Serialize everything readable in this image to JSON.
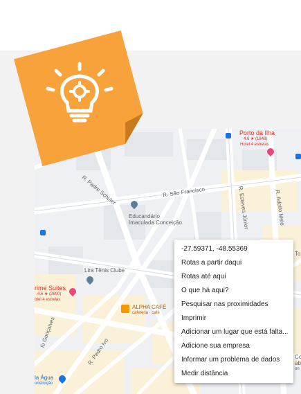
{
  "map": {
    "streets": {
      "sao_francisco": "R. São Francisco",
      "padre_schuler": "R. Padre Schuler",
      "esteves_junior": "R. Esteves Júnior",
      "adolfo_melo": "R. Adolfo Melo",
      "pedro_ivo": "R. Pedro Ivo",
      "goncalves": "lo Gonçalves"
    },
    "places": {
      "porto_da_ilha": {
        "name": "Porto da Ilha",
        "rating": "4.6 ★ (1848)",
        "category": "Hotel 4 estrelas"
      },
      "educandario": {
        "name_line1": "Educandário",
        "name_line2": "Imaculada Conceição"
      },
      "lira_tenis": {
        "name": "Lira Tênis Clube"
      },
      "prime_suites": {
        "name": "rime Suites",
        "rating": "4.6 ★ (2600)",
        "category": "otel 4 estrelas"
      },
      "alpha_cafe": {
        "name": "ALPHA CAFÉ",
        "category": "cafeteria · café"
      },
      "la_agua": {
        "name": "la Água",
        "category": "onstrução"
      },
      "edge_to": "To",
      "edge_co": "Co",
      "edge_ab": "ab",
      "edge_on": "on"
    }
  },
  "context_menu": {
    "items": [
      "-27.59371, -48.55369",
      "Rotas a partir daqui",
      "Rotas até aqui",
      "O que há aqui?",
      "Pesquisar nas proximidades",
      "Imprimir",
      "Adicionar um lugar que está falta...",
      "Adicione sua empresa",
      "Informar um problema de dados",
      "Medir distância"
    ]
  },
  "colors": {
    "sticky_note": "#f8a23b",
    "sticky_fold": "#c97a1f",
    "hotel_pin": "#e8467c",
    "place_pin": "#5f7d95",
    "transit_pin": "#1a73e8",
    "cafe_pin": "#f29900"
  },
  "icons": {
    "sticky": "lightbulb-gear-icon"
  }
}
